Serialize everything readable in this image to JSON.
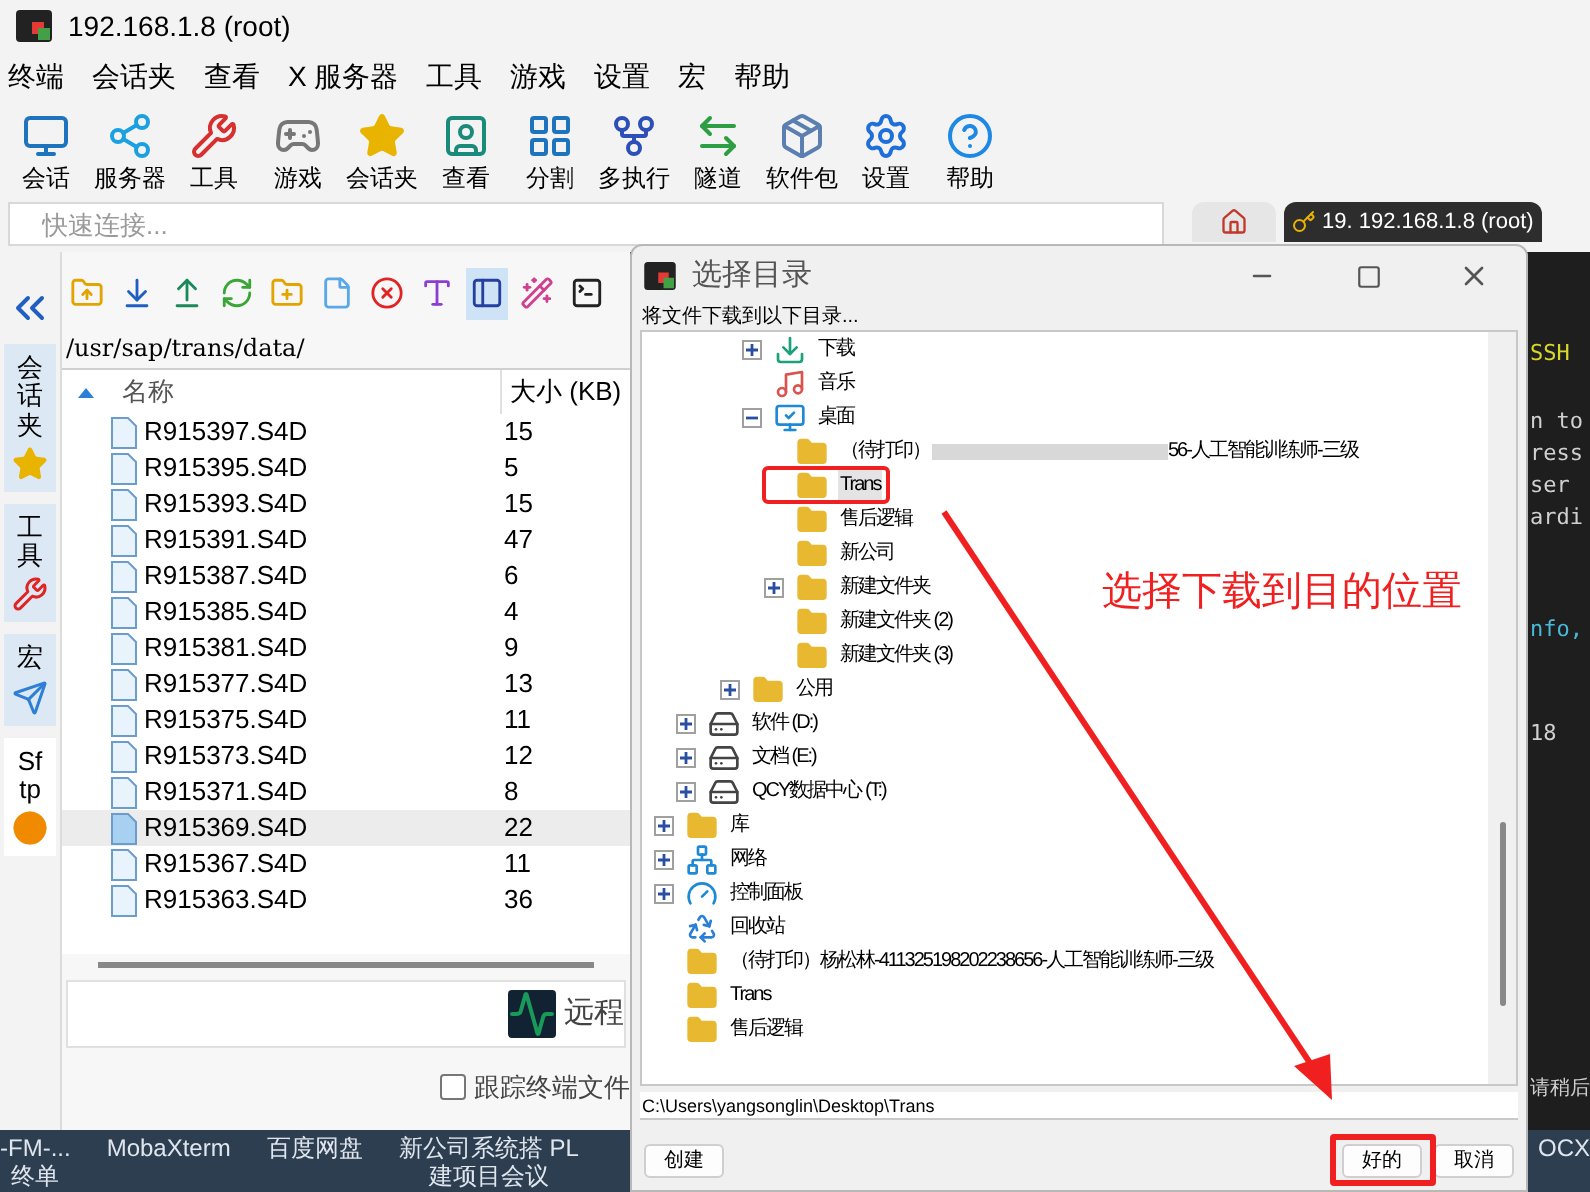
{
  "window": {
    "title": "192.168.1.8 (root)"
  },
  "menu": [
    "终端",
    "会话夹",
    "查看",
    "X 服务器",
    "工具",
    "游戏",
    "设置",
    "宏",
    "帮助"
  ],
  "toolbar": [
    {
      "label": "会话",
      "kind": "session"
    },
    {
      "label": "服务器",
      "kind": "servers"
    },
    {
      "label": "工具",
      "kind": "tools"
    },
    {
      "label": "游戏",
      "kind": "games"
    },
    {
      "label": "会话夹",
      "kind": "sessions"
    },
    {
      "label": "查看",
      "kind": "view"
    },
    {
      "label": "分割",
      "kind": "split"
    },
    {
      "label": "多执行",
      "kind": "multiexec"
    },
    {
      "label": "隧道",
      "kind": "tunnel"
    },
    {
      "label": "软件包",
      "kind": "packages"
    },
    {
      "label": "设置",
      "kind": "settings"
    },
    {
      "label": "帮助",
      "kind": "help"
    }
  ],
  "quick_connect": {
    "placeholder": "快速连接..."
  },
  "terminal_tabs": [
    {
      "kind": "home",
      "selected": false
    },
    {
      "kind": "terminal",
      "label": "19. 192.168.1.8 (root)",
      "selected": true
    }
  ],
  "side_tabs": [
    {
      "label": "会话夹",
      "kind": "sessions",
      "selected": false
    },
    {
      "label": "工具",
      "kind": "tools",
      "selected": false
    },
    {
      "label": "宏",
      "kind": "macros",
      "selected": false
    },
    {
      "label": "Sftp",
      "kind": "sftp",
      "selected": true
    }
  ],
  "sftp": {
    "tools": [
      {
        "kind": "parent",
        "on": false
      },
      {
        "kind": "download",
        "on": false
      },
      {
        "kind": "upload",
        "on": false
      },
      {
        "kind": "refresh",
        "on": false
      },
      {
        "kind": "new-folder",
        "on": false
      },
      {
        "kind": "new-file",
        "on": false
      },
      {
        "kind": "delete",
        "on": false
      },
      {
        "kind": "rename",
        "on": false
      },
      {
        "kind": "panel",
        "on": true
      },
      {
        "kind": "wand",
        "on": false
      },
      {
        "kind": "terminal",
        "on": false
      }
    ],
    "path": "/usr/sap/trans/data/",
    "columns": [
      "名称",
      "大小 (KB)"
    ],
    "rows": [
      {
        "name": "R915397.S4D",
        "size": "15",
        "selected": false
      },
      {
        "name": "R915395.S4D",
        "size": "5",
        "selected": false
      },
      {
        "name": "R915393.S4D",
        "size": "15",
        "selected": false
      },
      {
        "name": "R915391.S4D",
        "size": "47",
        "selected": false
      },
      {
        "name": "R915387.S4D",
        "size": "6",
        "selected": false
      },
      {
        "name": "R915385.S4D",
        "size": "4",
        "selected": false
      },
      {
        "name": "R915381.S4D",
        "size": "9",
        "selected": false
      },
      {
        "name": "R915377.S4D",
        "size": "13",
        "selected": false
      },
      {
        "name": "R915375.S4D",
        "size": "11",
        "selected": false
      },
      {
        "name": "R915373.S4D",
        "size": "12",
        "selected": false
      },
      {
        "name": "R915371.S4D",
        "size": "8",
        "selected": false
      },
      {
        "name": "R915369.S4D",
        "size": "22",
        "selected": true
      },
      {
        "name": "R915367.S4D",
        "size": "11",
        "selected": false
      },
      {
        "name": "R915363.S4D",
        "size": "36",
        "selected": false
      }
    ],
    "monitor_button": "远程",
    "follow_checkbox": {
      "label": "跟踪终端文件",
      "checked": false
    }
  },
  "terminal": [
    {
      "text": "SSH",
      "kind": "highlight"
    },
    {
      "text": "n to",
      "kind": "plain"
    },
    {
      "text": "ress",
      "kind": "plain"
    },
    {
      "text": "ser",
      "kind": "plain"
    },
    {
      "text": "ardi",
      "kind": "plain"
    },
    {
      "text": "nfo,",
      "kind": "link"
    },
    {
      "text": "18",
      "kind": "plain"
    },
    {
      "text": "请稍后",
      "kind": "plain"
    }
  ],
  "taskbar": [
    {
      "label": "-FM-...",
      "sub": "终单"
    },
    {
      "label": "MobaXterm"
    },
    {
      "label": "百度网盘"
    },
    {
      "label": "新公司系统搭 PL",
      "sub": "建项目会议"
    },
    {
      "label": "OCX"
    }
  ],
  "dialog": {
    "title": "选择目录",
    "prompt": "将文件下载到以下目录...",
    "tree": [
      {
        "children": [
          {
            "children": [
              {
                "children": [
                  {
                    "children": [
                      {
                        "label": "下载",
                        "kind": "download",
                        "expanded": false,
                        "selected": false
                      },
                      {
                        "label": "音乐",
                        "kind": "music",
                        "selected": false
                      },
                      {
                        "label": "桌面",
                        "kind": "desktop",
                        "expanded": true,
                        "selected": false,
                        "children": [
                          {
                            "label": "（待打印）",
                            "redacted": true,
                            "label_end": "56-人工智能训练师-三级",
                            "kind": "folder",
                            "selected": false
                          },
                          {
                            "label": "Trans",
                            "kind": "folder",
                            "selected": true,
                            "marked": true
                          },
                          {
                            "label": "售后逻辑",
                            "kind": "folder",
                            "selected": false
                          },
                          {
                            "label": "新公司",
                            "kind": "folder",
                            "selected": false
                          },
                          {
                            "label": "新建文件夹",
                            "kind": "folder",
                            "expanded": false,
                            "selected": false
                          },
                          {
                            "label": "新建文件夹 (2)",
                            "kind": "folder",
                            "selected": false
                          },
                          {
                            "label": "新建文件夹 (3)",
                            "kind": "folder",
                            "selected": false
                          }
                        ]
                      }
                    ]
                  },
                  {
                    "label": "公用",
                    "kind": "folder",
                    "expanded": false,
                    "selected": false
                  }
                ]
              }
            ]
          },
          {
            "label": "软件 (D:)",
            "kind": "drive",
            "expanded": false,
            "selected": false
          },
          {
            "label": "文档 (E:)",
            "kind": "drive",
            "expanded": false,
            "selected": false
          },
          {
            "label": "QCY数据中心 (T:)",
            "kind": "drive",
            "expanded": false,
            "selected": false
          }
        ]
      },
      {
        "label": "库",
        "kind": "folder",
        "expanded": false,
        "selected": false
      },
      {
        "label": "网络",
        "kind": "network",
        "expanded": false,
        "selected": false
      },
      {
        "label": "控制面板",
        "kind": "control",
        "expanded": false,
        "selected": false
      },
      {
        "label": "回收站",
        "kind": "recycle",
        "selected": false
      },
      {
        "label": "（待打印）杨松林-411325198202238656-人工智能训练师-三级",
        "kind": "folder",
        "selected": false
      },
      {
        "label": "Trans",
        "kind": "folder",
        "selected": false
      },
      {
        "label": "售后逻辑",
        "kind": "folder",
        "selected": false
      }
    ],
    "path": "C:\\Users\\yangsonglin\\Desktop\\Trans",
    "buttons": [
      {
        "label": "创建",
        "kind": "create"
      },
      {
        "label": "好的",
        "kind": "ok"
      },
      {
        "label": "取消",
        "kind": "cancel"
      }
    ]
  },
  "annotation": {
    "caption": "选择下载到目的位置"
  }
}
